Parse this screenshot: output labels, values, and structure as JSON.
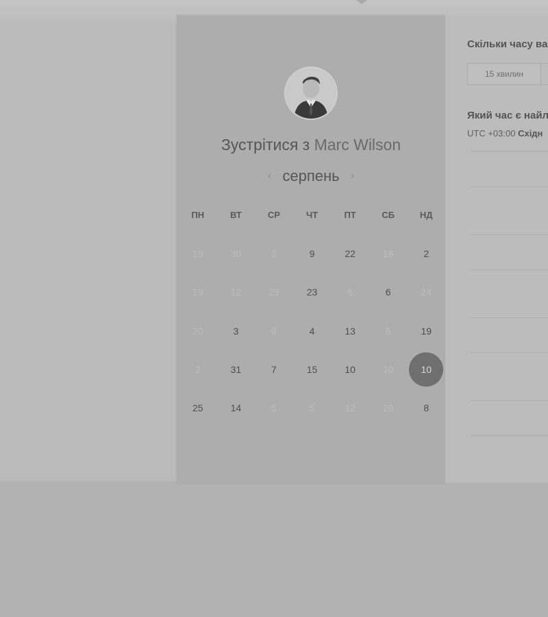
{
  "calendar": {
    "title_prefix": "Зустрітися з",
    "host_name": "Marc Wilson",
    "month": "серпень",
    "prev_icon": "‹",
    "next_icon": "›",
    "weekdays": [
      "ПН",
      "ВТ",
      "СР",
      "ЧТ",
      "ПТ",
      "СБ",
      "НД"
    ],
    "rows": [
      [
        "19",
        "30",
        "2",
        "9",
        "22",
        "16",
        "2"
      ],
      [
        "19",
        "12",
        "29",
        "23",
        "6",
        "6",
        "24"
      ],
      [
        "20",
        "3",
        "9",
        "4",
        "13",
        "5",
        "19"
      ],
      [
        "2",
        "31",
        "7",
        "15",
        "10",
        "10",
        "10"
      ],
      [
        "25",
        "14",
        "5",
        "5",
        "12",
        "26",
        "8"
      ]
    ],
    "selected_day": "10"
  },
  "booking": {
    "duration_question": "Скільки часу ва",
    "duration_option": "15 хвилин",
    "time_question": "Який час є найл",
    "timezone_offset": "UTC +03:00",
    "timezone_name": "Східн"
  }
}
